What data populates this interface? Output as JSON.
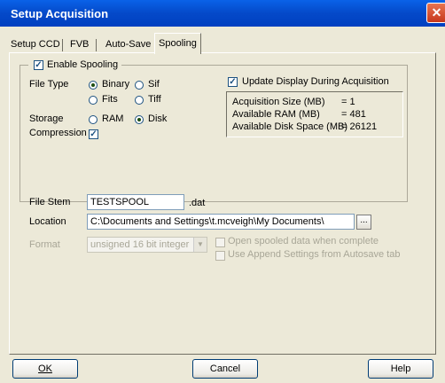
{
  "window": {
    "title": "Setup Acquisition",
    "close_glyph": "✕"
  },
  "tabs": [
    {
      "label": "Setup CCD"
    },
    {
      "label": "FVB"
    },
    {
      "label": "Auto-Save"
    },
    {
      "label": "Spooling"
    }
  ],
  "spooling": {
    "enable_label": "Enable Spooling",
    "enable_checked": true,
    "file_type": {
      "label": "File Type",
      "options": [
        "Binary",
        "Sif",
        "Fits",
        "Tiff"
      ],
      "selected": "Binary"
    },
    "storage": {
      "label": "Storage",
      "options": [
        "RAM",
        "Disk"
      ],
      "selected": "Disk"
    },
    "compression": {
      "label": "Compression",
      "checked": true
    },
    "file_stem": {
      "label": "File Stem",
      "value": "TESTSPOOL",
      "extension": ".dat"
    },
    "location": {
      "label": "Location",
      "value": "C:\\Documents and Settings\\t.mcveigh\\My Documents\\",
      "browse_label": "..."
    },
    "format": {
      "label": "Format",
      "value": "unsigned 16 bit integer"
    },
    "open_spooled_label": "Open spooled data when complete",
    "use_append_label": "Use Append Settings from Autosave tab",
    "update_display": {
      "label": "Update Display During Acquisition",
      "checked": true
    },
    "info": {
      "acq_size_label": "Acquisition Size (MB)",
      "acq_size_value": "= 1",
      "avail_ram_label": "Available RAM (MB)",
      "avail_ram_value": "= 481",
      "avail_disk_label": "Available Disk Space (MB)",
      "avail_disk_value": "= 26121"
    }
  },
  "buttons": {
    "ok": "OK",
    "cancel": "Cancel",
    "help": "Help"
  },
  "colors": {
    "title_bar": "#0449c9",
    "dialog_bg": "#ece9d8",
    "close_button": "#c7381c"
  }
}
